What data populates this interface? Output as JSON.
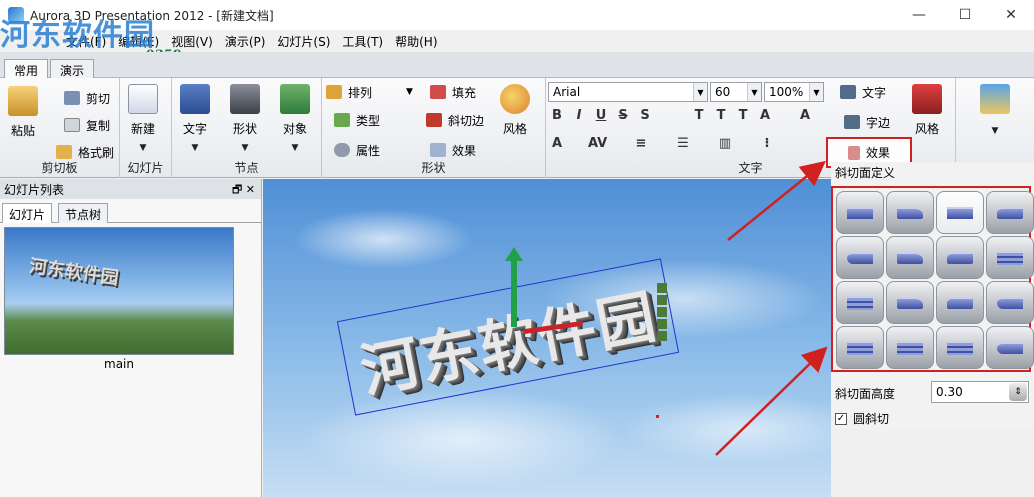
{
  "window": {
    "title": "Aurora 3D Presentation 2012 - [新建文档]",
    "minimize_glyph": "—",
    "maximize_glyph": "☐",
    "close_glyph": "✕"
  },
  "watermark": {
    "text": "河东软件园",
    "url": "www.pc0359.cn"
  },
  "menu": [
    "文件(F)",
    "编辑(E)",
    "视图(V)",
    "演示(P)",
    "幻灯片(S)",
    "工具(T)",
    "帮助(H)"
  ],
  "ribbon_tabs": [
    "常用",
    "演示"
  ],
  "ribbon": {
    "clipboard": {
      "label": "剪切板",
      "paste": "粘贴",
      "cut": "剪切",
      "copy": "复制",
      "format_brush": "格式刷"
    },
    "slides": {
      "label": "幻灯片",
      "new": "新建"
    },
    "nodes": {
      "label": "节点",
      "text": "文字",
      "shape": "形状",
      "object": "对象"
    },
    "shape": {
      "label": "形状",
      "arrange": "排列",
      "type": "类型",
      "property": "属性",
      "fill": "填充",
      "bevel": "斜切边",
      "effect": "效果",
      "style": "风格"
    },
    "text": {
      "label": "文字",
      "font": "Arial",
      "size": "60",
      "zoom": "100%",
      "format_buttons": [
        "B",
        "I",
        "U",
        "S",
        "S",
        "T",
        "T",
        "T",
        "A",
        "A"
      ],
      "text_btn": "文字",
      "outline_btn": "字边",
      "effect_btn": "效果",
      "style_btn": "风格"
    }
  },
  "left_panel": {
    "title": "幻灯片列表",
    "tabs": [
      "幻灯片",
      "节点树"
    ],
    "thumb_text": "河东软件园",
    "thumb_label": "main",
    "float_glyph": "🗗",
    "close_glyph": "✕"
  },
  "canvas": {
    "text": "河东软件园"
  },
  "right_panel": {
    "title": "斜切面定义",
    "bevel_height_label": "斜切面高度",
    "bevel_height_value": "0.30",
    "round_bevel_label": "圆斜切",
    "round_bevel_checked": true
  },
  "colors": {
    "highlight_red": "#d12020",
    "accent_blue": "#2a7fd2"
  }
}
